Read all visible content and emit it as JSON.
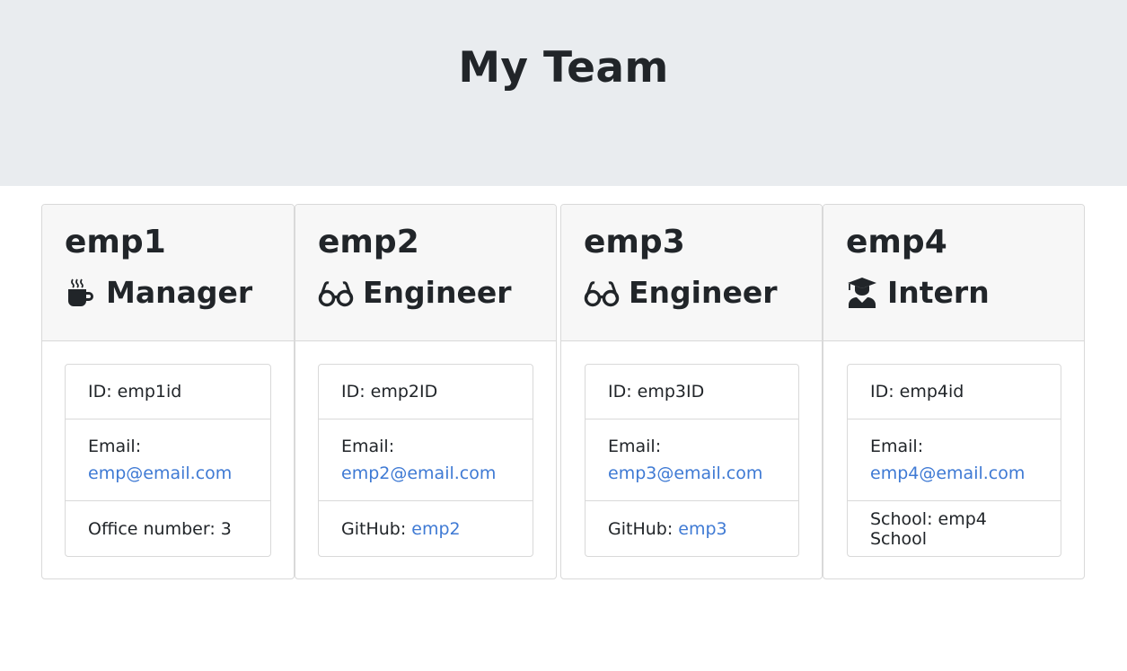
{
  "header": {
    "title": "My Team"
  },
  "employees": [
    {
      "name": "emp1",
      "role": "Manager",
      "role_icon": "coffee-icon",
      "id_label": "ID: emp1id",
      "email_label": "Email:",
      "email": "emp@email.com",
      "extra_label": "Office number: 3",
      "extra_link": ""
    },
    {
      "name": "emp2",
      "role": "Engineer",
      "role_icon": "glasses-icon",
      "id_label": "ID: emp2ID",
      "email_label": "Email:",
      "email": "emp2@email.com",
      "extra_label": "GitHub: ",
      "extra_link": "emp2"
    },
    {
      "name": "emp3",
      "role": "Engineer",
      "role_icon": "glasses-icon",
      "id_label": "ID: emp3ID",
      "email_label": "Email:",
      "email": "emp3@email.com",
      "extra_label": "GitHub: ",
      "extra_link": "emp3"
    },
    {
      "name": "emp4",
      "role": "Intern",
      "role_icon": "graduate-icon",
      "id_label": "ID: emp4id",
      "email_label": "Email:",
      "email": "emp4@email.com",
      "extra_label": "School: emp4 School",
      "extra_link": ""
    }
  ],
  "colors": {
    "link": "#3f7ad4",
    "header_bg": "#e9ecef",
    "card_header_bg": "#f7f7f7"
  }
}
